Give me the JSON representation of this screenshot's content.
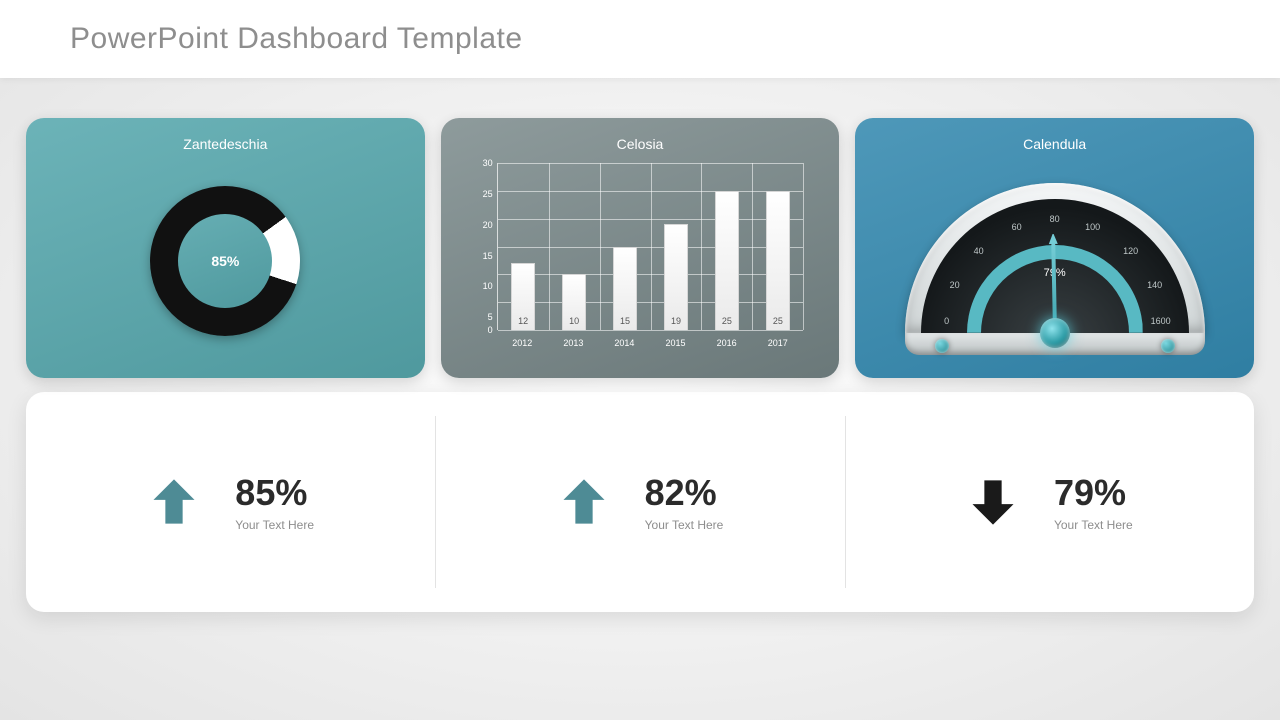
{
  "header": {
    "title": "PowerPoint Dashboard Template"
  },
  "cards": {
    "donut": {
      "title": "Zantedeschia",
      "center_label": "85%"
    },
    "bars": {
      "title": "Celosia"
    },
    "gauge": {
      "title": "Calendula",
      "value_label": "79%",
      "ticks": {
        "t0": "0",
        "t20": "20",
        "t40": "40",
        "t60": "60",
        "t80": "80",
        "t100": "100",
        "t120": "120",
        "t140": "140",
        "t1600": "1600"
      }
    }
  },
  "stats": [
    {
      "dir": "up",
      "pct": "85%",
      "sub": "Your Text Here"
    },
    {
      "dir": "up",
      "pct": "82%",
      "sub": "Your Text Here"
    },
    {
      "dir": "down",
      "pct": "79%",
      "sub": "Your Text Here"
    }
  ],
  "chart_data": [
    {
      "type": "donut",
      "title": "Zantedeschia",
      "value": 85,
      "max": 100,
      "segments": [
        {
          "name": "filled",
          "value": 85,
          "color": "#111111"
        },
        {
          "name": "gap",
          "value": 15,
          "color": "#ffffff"
        }
      ],
      "center_label": "85%"
    },
    {
      "type": "bar",
      "title": "Celosia",
      "categories": [
        "2012",
        "2013",
        "2014",
        "2015",
        "2016",
        "2017"
      ],
      "values": [
        12,
        10,
        15,
        19,
        25,
        25
      ],
      "xlabel": "",
      "ylabel": "",
      "ylim": [
        0,
        30
      ],
      "yticks": [
        0,
        5,
        10,
        15,
        20,
        25,
        30
      ],
      "grid": true
    },
    {
      "type": "gauge",
      "title": "Calendula",
      "value": 79,
      "min": 0,
      "max": 160,
      "major_ticks": [
        0,
        20,
        40,
        60,
        80,
        100,
        120,
        140,
        160
      ],
      "tick_labels": [
        "0",
        "20",
        "40",
        "60",
        "80",
        "100",
        "120",
        "140",
        "1600"
      ],
      "value_label": "79%"
    }
  ]
}
